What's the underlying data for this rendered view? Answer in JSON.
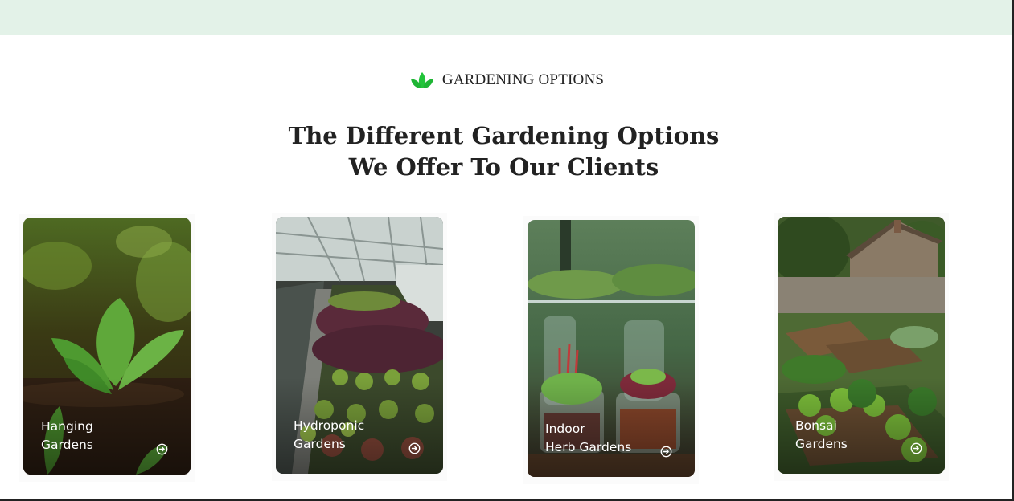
{
  "section": {
    "eyebrow": "GARDENING OPTIONS",
    "eyebrow_icon": "leaf-icon",
    "heading_line1": "The Different Gardening Options",
    "heading_line2": "We Offer To Our Clients"
  },
  "cards": [
    {
      "title_line1": "Hanging",
      "title_line2": "Gardens",
      "icon": "arrow-circle-right-icon"
    },
    {
      "title_line1": "Hydroponic",
      "title_line2": "Gardens",
      "icon": "arrow-circle-right-icon"
    },
    {
      "title_line1": "Indoor",
      "title_line2": "Herb Gardens",
      "icon": "arrow-circle-right-icon"
    },
    {
      "title_line1": "Bonsai",
      "title_line2": "Gardens",
      "icon": "arrow-circle-right-icon"
    }
  ],
  "colors": {
    "top_band": "#e3f2e8",
    "accent_green": "#2ecc40",
    "heading_text": "#222222"
  }
}
